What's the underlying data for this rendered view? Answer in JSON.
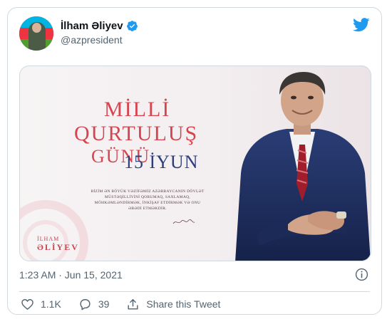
{
  "tweet": {
    "author": {
      "display_name": "İlham Əliyev",
      "handle": "@azpresident",
      "verified": true,
      "avatar_icon": "avatar-photo-with-flag"
    },
    "brand_icon": "twitter-bird-icon",
    "brand_color": "#1d9bf0",
    "media": {
      "title_line1": "MİLLİ",
      "title_line2": "QURTULUŞ",
      "title_line3": "GÜNÜ",
      "date_text": "15 İYUN",
      "quote": "BİZİM ƏN BÖYÜK VƏZİFƏMİZ AZƏRBAYCANIN DÖVLƏT MÜSTƏQİLLİYİNİ QORUMAQ, SAXLAMAQ, MÖHKƏMLƏNDİRMƏK, İNKİŞAF ETDİRMƏK VƏ ONU ƏBƏDİ ETMƏKDİR.",
      "brand_line1": "İLHAM",
      "brand_line2": "ƏLİYEV",
      "accent_color": "#d6454f",
      "date_color": "#2c3f7a"
    },
    "timestamp": "1:23 AM · Jun 15, 2021",
    "info_icon": "info-icon",
    "actions": {
      "likes": "1.1K",
      "replies": "39",
      "share_label": "Share this Tweet"
    }
  }
}
